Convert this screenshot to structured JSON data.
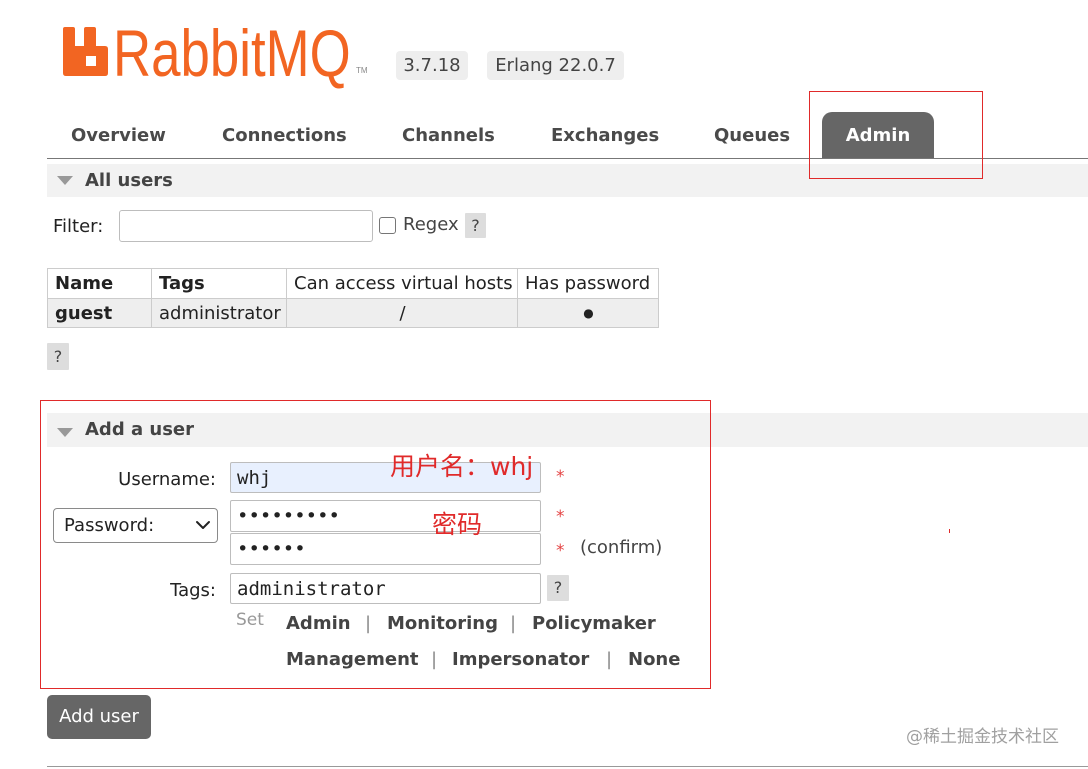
{
  "app": {
    "logo_text": "RabbitMQ",
    "logo_tm": "TM",
    "version": "3.7.18",
    "erlang": "Erlang 22.0.7"
  },
  "tabs": [
    {
      "label": "Overview",
      "active": false
    },
    {
      "label": "Connections",
      "active": false
    },
    {
      "label": "Channels",
      "active": false
    },
    {
      "label": "Exchanges",
      "active": false
    },
    {
      "label": "Queues",
      "active": false
    },
    {
      "label": "Admin",
      "active": true
    }
  ],
  "all_users": {
    "title": "All users",
    "filter_label": "Filter:",
    "filter_value": "",
    "regex_label": "Regex",
    "regex_checked": false,
    "help": "?",
    "columns": [
      "Name",
      "Tags",
      "Can access virtual hosts",
      "Has password"
    ],
    "rows": [
      {
        "name": "guest",
        "tags": "administrator",
        "vhosts": "/",
        "has_password": "●"
      }
    ],
    "table_help": "?"
  },
  "add_user": {
    "title": "Add a user",
    "username_label": "Username:",
    "username_value": "whj",
    "credential_type": "Password:",
    "password_masked": "•••••••••",
    "confirm_masked": "••••••",
    "required_mark": "*",
    "confirm_label": "(confirm)",
    "tags_label": "Tags:",
    "tags_value": "administrator",
    "tags_help": "?",
    "set_label": "Set",
    "tag_shortcuts": [
      "Admin",
      "Monitoring",
      "Policymaker",
      "Management",
      "Impersonator",
      "None"
    ],
    "separator": "|",
    "submit_label": "Add user"
  },
  "annotations": {
    "username_note": "用户名：whj",
    "password_note": "密码"
  },
  "watermark": "@稀土掘金技术社区",
  "colors": {
    "brand_orange": "#f26522",
    "active_tab": "#666666",
    "button": "#666666",
    "annotation_red": "#e02a2a",
    "required_red": "#e44444",
    "section_band": "#f2f2f2",
    "autofill_blue": "#e8f0fe"
  },
  "icons": {
    "logo": "rabbitmq-logo-icon",
    "section_toggle": "triangle-down-icon",
    "select_arrow": "chevron-down-icon"
  }
}
